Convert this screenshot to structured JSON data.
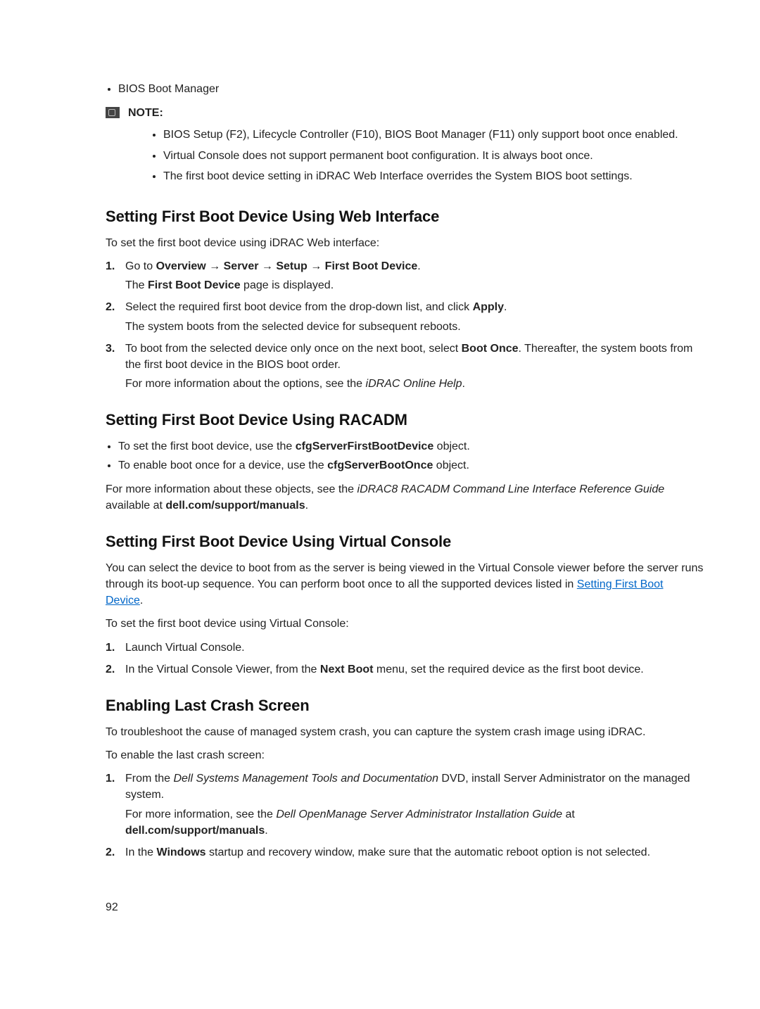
{
  "top_bullets": [
    "BIOS Boot Manager"
  ],
  "note": {
    "label": "NOTE:",
    "items": [
      "BIOS Setup (F2), Lifecycle Controller (F10), BIOS Boot Manager (F11) only support boot once enabled.",
      "Virtual Console does not support permanent boot configuration. It is always boot once.",
      "The first boot device setting in iDRAC Web Interface overrides the System BIOS boot settings."
    ]
  },
  "sec_web": {
    "title": "Setting First Boot Device Using Web Interface",
    "intro": "To set the first boot device using iDRAC Web interface:",
    "s1a": "Go to ",
    "s1b_path": "Overview → Server → Setup → First Boot Device",
    "s1d": ".",
    "s1_p2a": "The ",
    "s1_p2b": "First Boot Device",
    "s1_p2c": " page is displayed.",
    "s2a": "Select the required first boot device from the drop-down list, and click ",
    "s2b": "Apply",
    "s2c": ".",
    "s2_p2": "The system boots from the selected device for subsequent reboots.",
    "s3a": "To boot from the selected device only once on the next boot, select ",
    "s3b": "Boot Once",
    "s3c": ". Thereafter, the system boots from the first boot device in the BIOS boot order.",
    "s3_p2a": "For more information about the options, see the ",
    "s3_p2b": "iDRAC Online Help",
    "s3_p2c": "."
  },
  "sec_racadm": {
    "title": "Setting First Boot Device Using RACADM",
    "b1a": "To set the first boot device, use the ",
    "b1b": "cfgServerFirstBootDevice",
    "b1c": " object.",
    "b2a": "To enable boot once for a device, use the ",
    "b2b": "cfgServerBootOnce",
    "b2c": " object.",
    "p_a": "For more information about these objects, see the ",
    "p_b": "iDRAC8 RACADM Command Line Interface Reference Guide",
    "p_c": " available at ",
    "p_d": "dell.com/support/manuals",
    "p_e": "."
  },
  "sec_vc": {
    "title": "Setting First Boot Device Using Virtual Console",
    "p1a": "You can select the device to boot from as the server is being viewed in the Virtual Console viewer before the server runs through its boot-up sequence. You can perform boot once to all the supported devices listed in ",
    "p1_link": "Setting First Boot Device",
    "p1b": ".",
    "p2": "To set the first boot device using Virtual Console:",
    "s1": "Launch Virtual Console.",
    "s2a": "In the Virtual Console Viewer, from the ",
    "s2b": "Next Boot",
    "s2c": " menu, set the required device as the first boot device."
  },
  "sec_crash": {
    "title": "Enabling Last Crash Screen",
    "p1": "To troubleshoot the cause of managed system crash, you can capture the system crash image using iDRAC.",
    "p2": "To enable the last crash screen:",
    "s1a": "From the ",
    "s1b": "Dell Systems Management Tools and Documentation",
    "s1c": " DVD, install Server Administrator on the managed system.",
    "s1_p2a": "For more information, see the ",
    "s1_p2b": "Dell OpenManage Server Administrator Installation Guide",
    "s1_p2c": " at ",
    "s1_p2d": "dell.com/support/manuals",
    "s1_p2e": ".",
    "s2a": "In the ",
    "s2b": "Windows",
    "s2c": " startup and recovery window, make sure that the automatic reboot option is not selected."
  },
  "page_number": "92"
}
